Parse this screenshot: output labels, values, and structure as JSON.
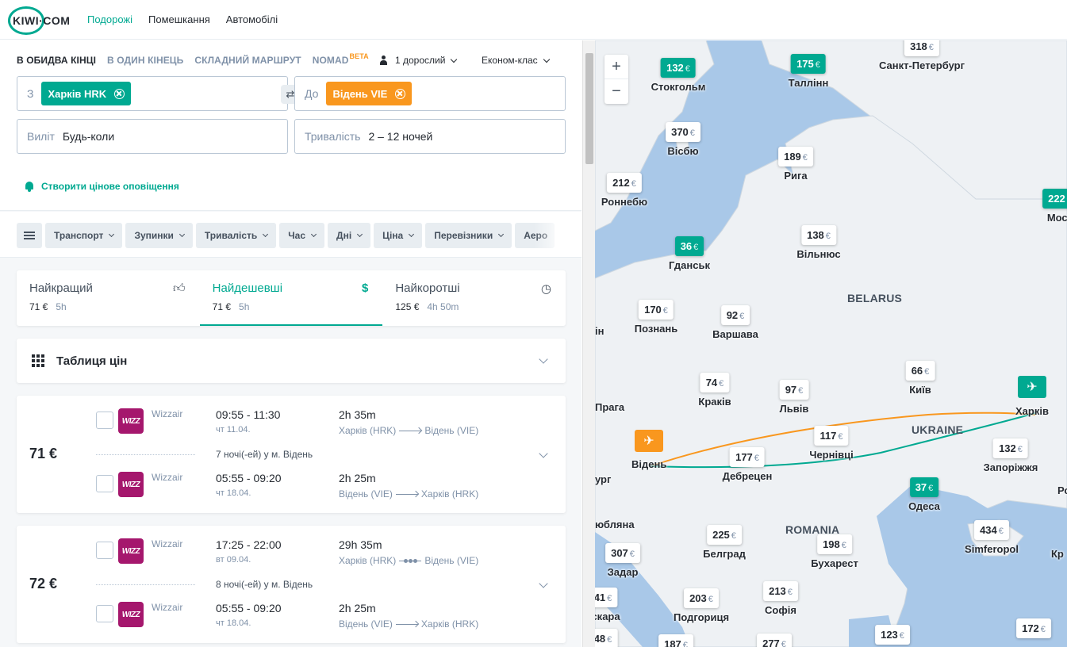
{
  "nav": {
    "logo": "KIWI·COM",
    "links": [
      "Подорожі",
      "Помешкання",
      "Автомобілі"
    ]
  },
  "search": {
    "trip_types": [
      "В ОБИДВА КІНЦІ",
      "В ОДИН КІНЕЦЬ",
      "СКЛАДНИЙ МАРШРУТ",
      "NOMAD"
    ],
    "beta": "BETA",
    "passengers": "1 дорослий",
    "cabin": "Економ-клас",
    "from_label": "З",
    "from_value": "Харків HRK",
    "to_label": "До",
    "to_value": "Відень VIE",
    "depart_label": "Виліт",
    "depart_value": "Будь-коли",
    "duration_label": "Тривалість",
    "duration_value": "2 – 12 ночей",
    "alert": "Створити цінове оповіщення"
  },
  "filters": [
    "Транспорт",
    "Зупинки",
    "Тривалість",
    "Час",
    "Дні",
    "Ціна",
    "Перевізники",
    "Аеро"
  ],
  "sort_tabs": [
    {
      "title": "Найкращий",
      "price": "71 €",
      "time": "5h",
      "icon": "thumbs-up-icon"
    },
    {
      "title": "Найдешевші",
      "price": "71 €",
      "time": "5h",
      "icon": "dollar-icon"
    },
    {
      "title": "Найкоротші",
      "price": "125 €",
      "time": "4h 50m",
      "icon": "clock-icon"
    }
  ],
  "price_table": {
    "title": "Таблиця цін"
  },
  "results": [
    {
      "price": "71 €",
      "outbound": {
        "carrier": "Wizzair",
        "times": "09:55 - 11:30",
        "date": "чт 11.04.",
        "duration": "2h 35m",
        "from": "Харків (HRK)",
        "to": "Відень (VIE)"
      },
      "nights": "7 ночі(-ей) у м. Відень",
      "inbound": {
        "carrier": "Wizzair",
        "times": "05:55 - 09:20",
        "date": "чт 18.04.",
        "duration": "2h 25m",
        "from": "Відень (VIE)",
        "to": "Харків (HRK)"
      }
    },
    {
      "price": "72 €",
      "outbound": {
        "carrier": "Wizzair",
        "times": "17:25 - 22:00",
        "date": "вт 09.04.",
        "duration": "29h 35m",
        "from": "Харків (HRK)",
        "to": "Відень (VIE)"
      },
      "nights": "8 ночі(-ей) у м. Відень",
      "inbound": {
        "carrier": "Wizzair",
        "times": "05:55 - 09:20",
        "date": "чт 18.04.",
        "duration": "2h 25m",
        "from": "Відень (VIE)",
        "to": "Харків (HRK)"
      }
    }
  ],
  "map": {
    "currency": "€",
    "regions": [
      "BELARUS",
      "UKRAINE",
      "ROMANIA"
    ],
    "pins": [
      {
        "price": "318",
        "city": "Санкт-Петербург"
      },
      {
        "price": "132",
        "city": "Стокгольм",
        "highlight": true
      },
      {
        "price": "175",
        "city": "Таллінн",
        "highlight": true
      },
      {
        "price": "370",
        "city": "Вісбю"
      },
      {
        "price": "189",
        "city": "Рига"
      },
      {
        "price": "212",
        "city": "Роннебю"
      },
      {
        "price": "222",
        "city": "Моск",
        "highlight": true
      },
      {
        "price": "36",
        "city": "Гданськ",
        "highlight": true
      },
      {
        "price": "138",
        "city": "Вільнюс"
      },
      {
        "price": "170",
        "city": "Познань"
      },
      {
        "price": "92",
        "city": "Варшава"
      },
      {
        "price": "74",
        "city": "Краків"
      },
      {
        "price": "97",
        "city": "Львів"
      },
      {
        "price": "66",
        "city": "Київ"
      },
      {
        "price": "117",
        "city": "Чернівці"
      },
      {
        "price": "177",
        "city": "Дебрецен"
      },
      {
        "price": "132",
        "city": "Запоріжжя"
      },
      {
        "price": "37",
        "city": "Одеса",
        "highlight": true
      },
      {
        "price": "225",
        "city": "Белград"
      },
      {
        "price": "198",
        "city": "Бухарест"
      },
      {
        "price": "434",
        "city": "Simferopol"
      },
      {
        "price": "307",
        "city": "Задар"
      },
      {
        "price": "203",
        "city": "Подгориця"
      },
      {
        "price": "213",
        "city": "Софія"
      },
      {
        "price": "123",
        "city": ""
      },
      {
        "price": "172",
        "city": ""
      },
      {
        "price": "187",
        "city": ""
      },
      {
        "price": "277",
        "city": ""
      },
      {
        "price": "41",
        "city": "ескара"
      },
      {
        "price": "48",
        "city": ""
      }
    ],
    "partial_cities": [
      "Прага",
      "Відень",
      "Харків",
      "ург",
      "ін",
      "юбляна",
      "Кр",
      "Ро"
    ]
  }
}
